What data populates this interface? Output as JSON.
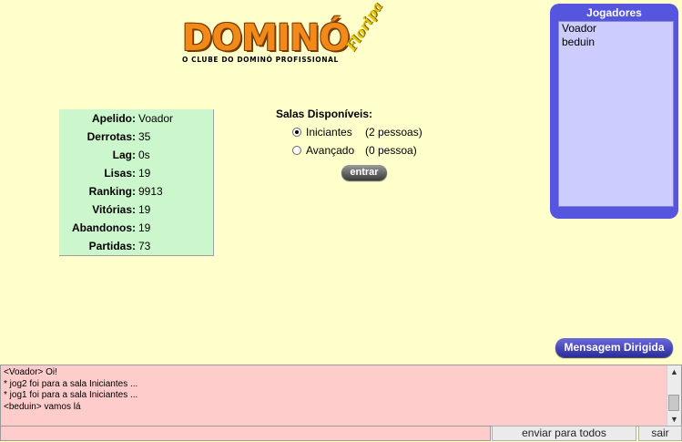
{
  "logo": {
    "word": "DOMINÓ",
    "tagline": "Floripa",
    "subtitle": "O CLUBE DO DOMINÓ PROFISSIONAL"
  },
  "stats": [
    {
      "label": "Apelido:",
      "value": "Voador"
    },
    {
      "label": "Derrotas:",
      "value": "35"
    },
    {
      "label": "Lag:",
      "value": "0s"
    },
    {
      "label": "Lisas:",
      "value": "19"
    },
    {
      "label": "Ranking:",
      "value": "9913"
    },
    {
      "label": "Vitórias:",
      "value": "19"
    },
    {
      "label": "Abandonos:",
      "value": "19"
    },
    {
      "label": "Partidas:",
      "value": "73"
    }
  ],
  "rooms": {
    "title": "Salas Disponíveis:",
    "items": [
      {
        "name": "Iniciantes",
        "count": "(2 pessoas)",
        "selected": true
      },
      {
        "name": "Avançado",
        "count": "(0 pessoa)",
        "selected": false
      }
    ],
    "enter_label": "entrar"
  },
  "players": {
    "title": "Jogadores",
    "items": [
      "Voador",
      "beduin"
    ]
  },
  "directed_message_label": "Mensagem Dirigida",
  "chat": {
    "lines": [
      "<Voador> Oi!",
      "* jog2 foi para a sala Iniciantes ...",
      "* jog1 foi para a sala Iniciantes ...",
      "<beduin> vamos lá"
    ]
  },
  "input": {
    "value": ""
  },
  "send_label": "enviar para todos",
  "exit_label": "sair",
  "colors": {
    "background": "#ffffcc",
    "stats_bg": "#ccf7cc",
    "players_bg": "#5555dd",
    "players_list_bg": "#ccccff",
    "chat_bg": "#ffcccc"
  }
}
